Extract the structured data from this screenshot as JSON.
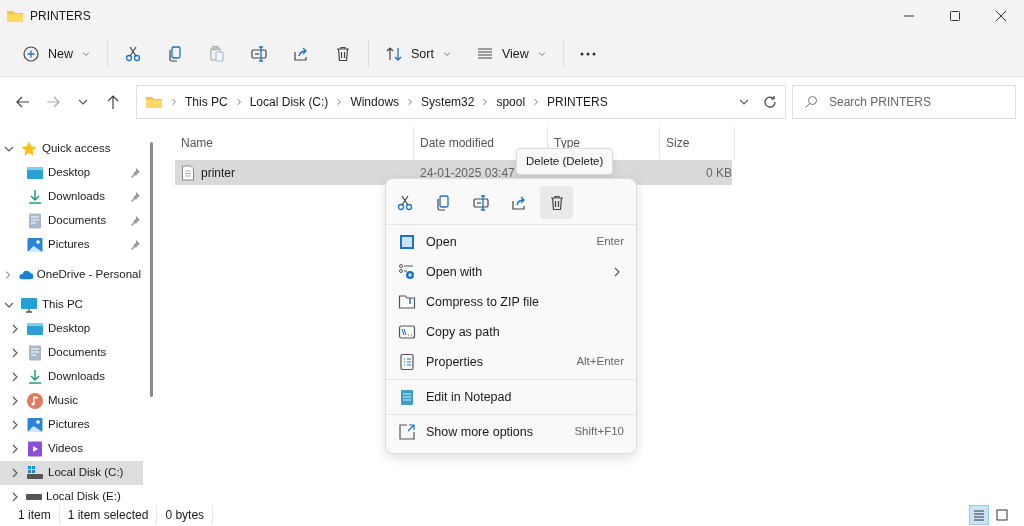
{
  "window": {
    "title": "PRINTERS"
  },
  "toolbar": [
    {
      "kind": "new",
      "label": "New",
      "disabled": false
    },
    {
      "kind": "cut",
      "disabled": false
    },
    {
      "kind": "copy",
      "disabled": false
    },
    {
      "kind": "paste",
      "disabled": true
    },
    {
      "kind": "rename",
      "disabled": false
    },
    {
      "kind": "share",
      "disabled": false
    },
    {
      "kind": "delete",
      "disabled": false
    },
    {
      "kind": "sort",
      "label": "Sort",
      "disabled": false
    },
    {
      "kind": "view",
      "label": "View",
      "disabled": false
    },
    {
      "kind": "more",
      "disabled": false
    }
  ],
  "address_bar": {
    "path": [
      "This PC",
      "Local Disk (C:)",
      "Windows",
      "System32",
      "spool",
      "PRINTERS"
    ]
  },
  "search": {
    "placeholder": "Search PRINTERS"
  },
  "sidebar": {
    "items": [
      {
        "kind": "star",
        "label": "Quick access",
        "expanded": true,
        "selected": false,
        "children": [
          {
            "kind": "desktop",
            "label": "Desktop",
            "pinned": true,
            "selected": false
          },
          {
            "kind": "downloads",
            "label": "Downloads",
            "pinned": true,
            "selected": false
          },
          {
            "kind": "documents",
            "label": "Documents",
            "pinned": true,
            "selected": false
          },
          {
            "kind": "pictures",
            "label": "Pictures",
            "pinned": true,
            "selected": false
          }
        ]
      },
      {
        "kind": "cloud",
        "label": "OneDrive - Personal",
        "expanded": false,
        "selected": false
      },
      {
        "kind": "pc",
        "label": "This PC",
        "expanded": true,
        "selected": false,
        "children": [
          {
            "kind": "desktop",
            "label": "Desktop",
            "expanded": false,
            "selected": false
          },
          {
            "kind": "documents",
            "label": "Documents",
            "expanded": false,
            "selected": false
          },
          {
            "kind": "downloads",
            "label": "Downloads",
            "expanded": false,
            "selected": false
          },
          {
            "kind": "music",
            "label": "Music",
            "expanded": false,
            "selected": false
          },
          {
            "kind": "pictures",
            "label": "Pictures",
            "expanded": false,
            "selected": false
          },
          {
            "kind": "videos",
            "label": "Videos",
            "expanded": false,
            "selected": false
          },
          {
            "kind": "drive_c",
            "label": "Local Disk (C:)",
            "expanded": false,
            "selected": true
          },
          {
            "kind": "drive",
            "label": "Local Disk (E:)",
            "expanded": false,
            "selected": false
          }
        ]
      }
    ]
  },
  "table": {
    "columns": [
      "Name",
      "Date modified",
      "Type",
      "Size"
    ],
    "rows": [
      {
        "name": "printer",
        "date_modified": "24-01-2025 03:47",
        "size": "0 KB",
        "selected": true
      }
    ]
  },
  "tooltip": {
    "text": "Delete (Delete)"
  },
  "context_menu": {
    "actions": [
      {
        "kind": "cut",
        "hovered": false
      },
      {
        "kind": "copy",
        "hovered": false
      },
      {
        "kind": "rename",
        "hovered": false
      },
      {
        "kind": "share",
        "hovered": false
      },
      {
        "kind": "delete",
        "hovered": true
      }
    ],
    "groups": [
      [
        {
          "kind": "open",
          "label": "Open",
          "shortcut": "Enter"
        },
        {
          "kind": "openwith",
          "label": "Open with",
          "submenu": true
        },
        {
          "kind": "zip",
          "label": "Compress to ZIP file"
        },
        {
          "kind": "path",
          "label": "Copy as path"
        },
        {
          "kind": "props",
          "label": "Properties",
          "shortcut": "Alt+Enter"
        }
      ],
      [
        {
          "kind": "notepad",
          "label": "Edit in Notepad"
        }
      ],
      [
        {
          "kind": "more",
          "label": "Show more options",
          "shortcut": "Shift+F10"
        }
      ]
    ]
  },
  "status_bar": {
    "texts": [
      "1 item",
      "1 item selected",
      "0 bytes"
    ],
    "views": [
      {
        "kind": "details",
        "selected": true
      },
      {
        "kind": "tiles",
        "selected": false
      }
    ]
  }
}
